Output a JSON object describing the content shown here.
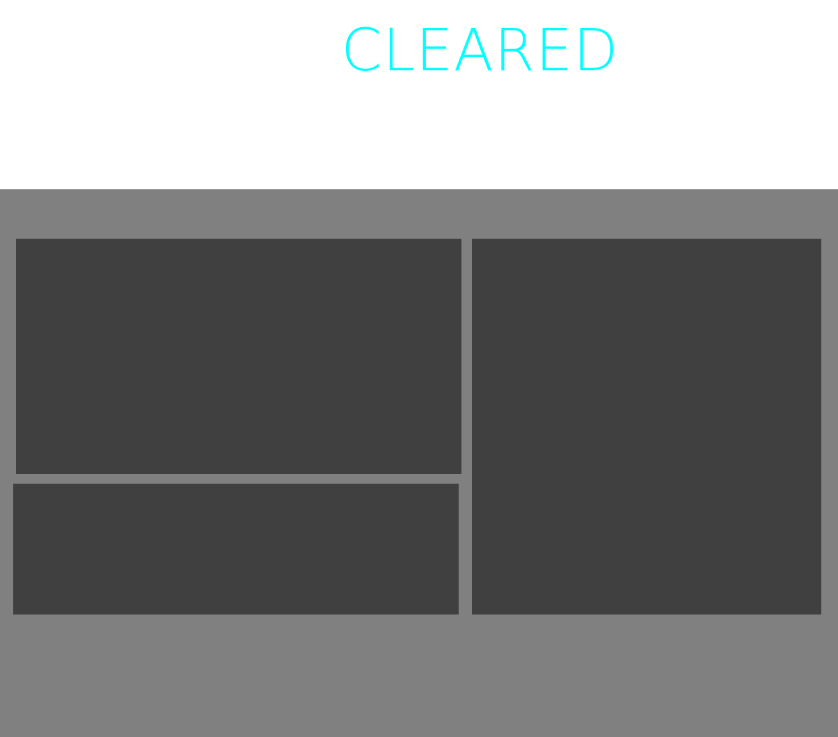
{
  "header": {
    "status_text": "CLEARED",
    "status_color": "#00ffff"
  },
  "colors": {
    "header_background": "#ffffff",
    "board_background": "#808080",
    "panel_background": "#404040"
  }
}
